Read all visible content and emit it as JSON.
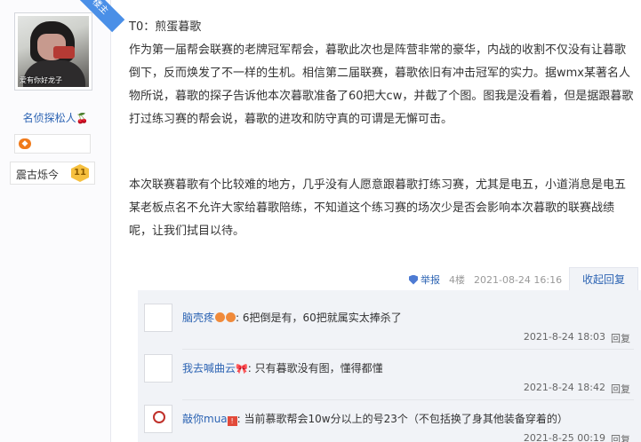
{
  "author": {
    "avatar_caption": "爱有你好龙子",
    "role_ribbon": "楼主",
    "name": "名侦探松人",
    "name_emoji": "🍒",
    "badge_icon": "gamepad-icon",
    "level_title": "震古烁今",
    "level_number": "11"
  },
  "post": {
    "paragraphs": [
      "T0：煎蛋暮歌",
      "作为第一届帮会联赛的老牌冠军帮会，暮歌此次也是阵营非常的豪华，内战的收割不仅没有让暮歌倒下，反而焕发了不一样的生机。相信第二届联赛，暮歌依旧有冲击冠军的实力。据wmx某著名人物所说，暮歌的探子告诉他本次暮歌准备了60把大cw，并截了个图。图我是没看着，但是据跟暮歌打过练习赛的帮会说，暮歌的进攻和防守真的可谓是无懈可击。",
      "本次联赛暮歌有个比较难的地方，几乎没有人愿意跟暮歌打练习赛，尤其是电五，小道消息是电五某老板点名不允许大家给暮歌陪练，不知道这个练习赛的场次少是否会影响本次暮歌的联赛战绩呢，让我们拭目以待。"
    ],
    "meta": {
      "report_label": "举报",
      "floor": "4楼",
      "timestamp": "2021-08-24 16:16"
    },
    "collapse_label": "收起回复"
  },
  "replies": [
    {
      "user": "脑壳疼",
      "user_suffix_icon": "angry-face-icon",
      "text": "6把倒是有，60把就属实太捧杀了",
      "time": "2021-8-24 18:03",
      "reply_label": "回复"
    },
    {
      "user": "我去喊曲云",
      "user_suffix_icon": "bow-icon",
      "text": "只有暮歌没有图，懂得都懂",
      "time": "2021-8-24 18:42",
      "reply_label": "回复"
    },
    {
      "user": "敲你mua",
      "user_suffix_icon": "warning-icon",
      "text": "当前慕歌帮会10w分以上的号23个（不包括换了身其他装备穿着的）",
      "time": "2021-8-25 00:19",
      "reply_label": "回复"
    }
  ],
  "colors": {
    "link": "#2d64b3",
    "ribbon": "#4a8fe7",
    "reply_bg": "#f1f3f7"
  }
}
